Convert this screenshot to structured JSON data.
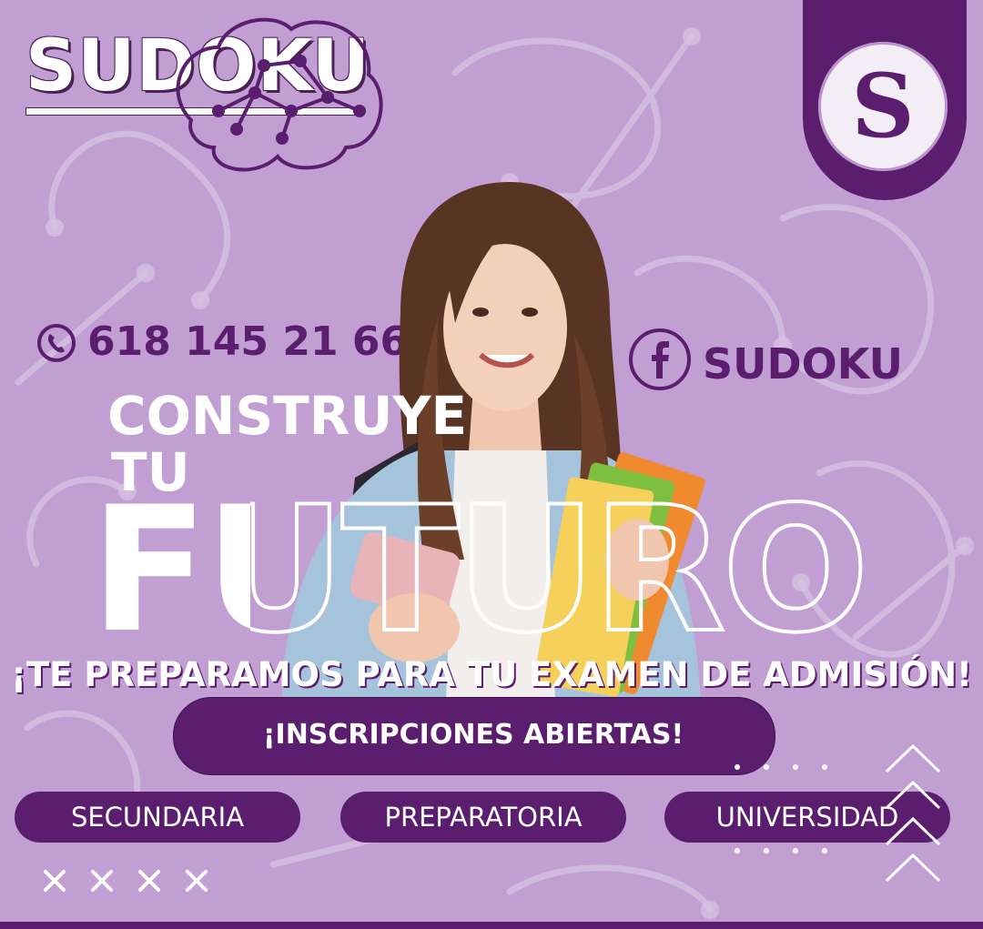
{
  "brand": {
    "title": "SUDOKU",
    "logo_letter": "S"
  },
  "contact": {
    "phone": "618 145 21 66",
    "facebook": "SUDOKU"
  },
  "headline": {
    "line1": "CONSTRUYE",
    "line2": "TU",
    "big": "FUTURO"
  },
  "tagline": "¡TE PREPARAMOS PARA TU EXAMEN DE ADMISIÓN!",
  "cta": {
    "label": "¡INSCRIPCIONES ABIERTAS!"
  },
  "levels": [
    {
      "label": "SECUNDARIA"
    },
    {
      "label": "PREPARATORIA"
    },
    {
      "label": "UNIVERSIDAD"
    }
  ],
  "colors": {
    "background": "#c19fd2",
    "brand_purple": "#5b1d6e",
    "text_white": "#ffffff"
  }
}
